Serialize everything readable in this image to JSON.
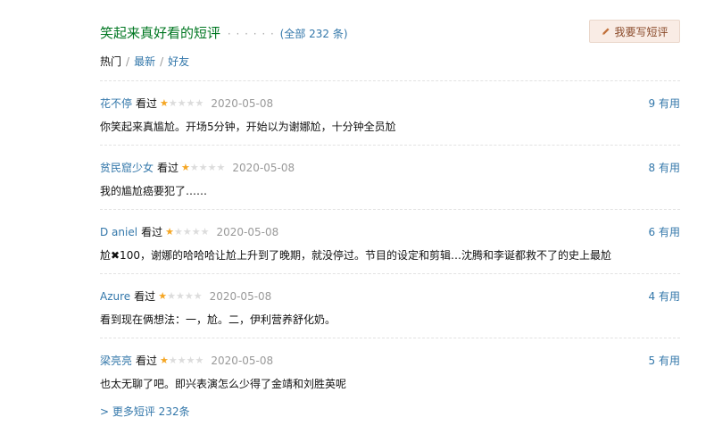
{
  "header": {
    "title": "笑起来真好看的短评",
    "dots": "· · · · · ·",
    "all_prefix": "(",
    "all_label": "全部 232 条",
    "all_suffix": ")",
    "write_button": "我要写短评"
  },
  "tabs": [
    {
      "label": "热门",
      "active": true
    },
    {
      "label": "最新",
      "active": false
    },
    {
      "label": "好友",
      "active": false
    }
  ],
  "tab_separator": "/",
  "comments": [
    {
      "user": "花不停",
      "status": "看过",
      "rating": 1,
      "rating_max": 5,
      "date": "2020-05-08",
      "votes": "9 有用",
      "content": "你笑起来真尴尬。开场5分钟，开始以为谢娜尬，十分钟全员尬"
    },
    {
      "user": "贫民窟少女",
      "status": "看过",
      "rating": 1,
      "rating_max": 5,
      "date": "2020-05-08",
      "votes": "8 有用",
      "content": "我的尴尬癌要犯了……"
    },
    {
      "user": "D aniel",
      "status": "看过",
      "rating": 1,
      "rating_max": 5,
      "date": "2020-05-08",
      "votes": "6 有用",
      "content": "尬✖100，谢娜的哈哈哈让尬上升到了晚期，就没停过。节目的设定和剪辑…沈腾和李诞都救不了的史上最尬"
    },
    {
      "user": "Azure",
      "status": "看过",
      "rating": 1,
      "rating_max": 5,
      "date": "2020-05-08",
      "votes": "4 有用",
      "content": "看到现在俩想法：一，尬。二，伊利营养舒化奶。"
    },
    {
      "user": "梁亮亮",
      "status": "看过",
      "rating": 1,
      "rating_max": 5,
      "date": "2020-05-08",
      "votes": "5 有用",
      "content": "也太无聊了吧。即兴表演怎么少得了金靖和刘胜英呢"
    }
  ],
  "more_link": "> 更多短评 232条"
}
